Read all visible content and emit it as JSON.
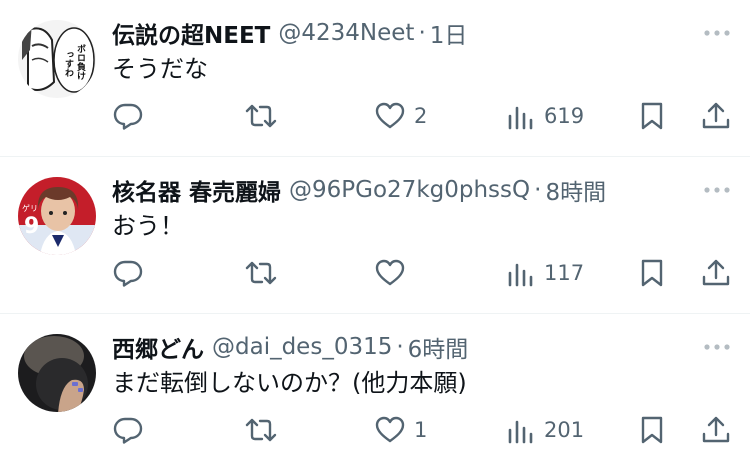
{
  "tweets": [
    {
      "name": "伝説の超NEET",
      "handle": "@4234Neet",
      "separator": "·",
      "time": "1日",
      "text": "そうだな",
      "avatar_text": "ボロ負けっすわ",
      "reply_count": "",
      "retweet_count": "",
      "like_count": "2",
      "view_count": "619"
    },
    {
      "name": "核名器 春売麗婦",
      "handle": "@96PGo27kg0phssQ",
      "separator": "·",
      "time": "8時間",
      "text": "おう！",
      "reply_count": "",
      "retweet_count": "",
      "like_count": "",
      "view_count": "117"
    },
    {
      "name": "西郷どん",
      "handle": "@dai_des_0315",
      "separator": "·",
      "time": "6時間",
      "text": "まだ転倒しないのか？(他力本願)",
      "reply_count": "",
      "retweet_count": "",
      "like_count": "1",
      "view_count": "201"
    }
  ],
  "icons": {
    "reply": "reply-icon",
    "retweet": "retweet-icon",
    "like": "heart-icon",
    "views": "views-icon",
    "bookmark": "bookmark-icon",
    "share": "share-icon",
    "more": "more-icon"
  },
  "colors": {
    "text_primary": "#0f1419",
    "text_secondary": "#536471",
    "divider": "#eff3f4"
  }
}
